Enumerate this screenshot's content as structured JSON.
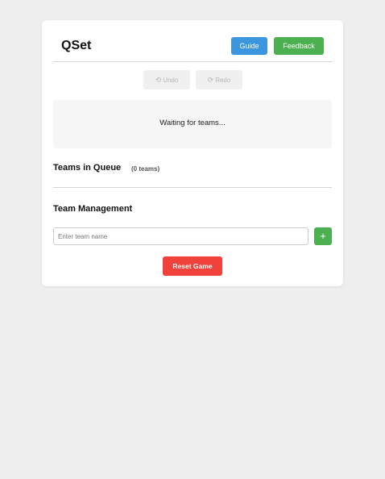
{
  "app": {
    "title": "QSet"
  },
  "header": {
    "guide_label": "Guide",
    "feedback_label": "Feedback"
  },
  "history": {
    "undo_label": "Undo",
    "redo_label": "Redo",
    "undo_icon": "undo-icon",
    "redo_icon": "redo-icon",
    "undo_glyph": "⟲",
    "redo_glyph": "⟳",
    "enabled": false
  },
  "status": {
    "message": "Waiting for teams..."
  },
  "queue": {
    "title": "Teams in Queue",
    "count_label": "(0 teams)",
    "count": 0,
    "teams": []
  },
  "management": {
    "title": "Team Management",
    "input_placeholder": "Enter team name",
    "input_value": "",
    "add_label": "+",
    "reset_label": "Reset Game"
  },
  "colors": {
    "guide": "#3b95df",
    "success": "#4caf50",
    "danger": "#f0413a",
    "background": "#eeeeee",
    "card": "#ffffff"
  }
}
